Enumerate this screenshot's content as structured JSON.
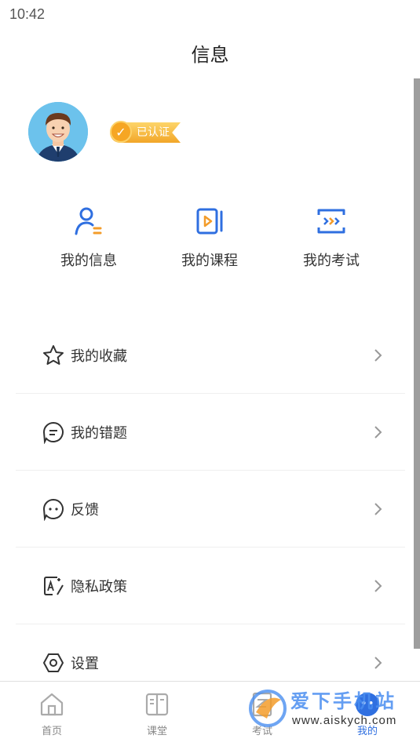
{
  "status_bar": {
    "time": "10:42"
  },
  "header": {
    "title": "信息"
  },
  "profile": {
    "verified_label": "已认证"
  },
  "shortcuts": [
    {
      "label": "我的信息",
      "icon": "user-info-icon"
    },
    {
      "label": "我的课程",
      "icon": "course-play-icon"
    },
    {
      "label": "我的考试",
      "icon": "exam-arrows-icon"
    }
  ],
  "menu": [
    {
      "label": "我的收藏",
      "icon": "star-icon"
    },
    {
      "label": "我的错题",
      "icon": "chat-lines-icon"
    },
    {
      "label": "反馈",
      "icon": "feedback-bubble-icon"
    },
    {
      "label": "隐私政策",
      "icon": "edit-doc-icon"
    },
    {
      "label": "设置",
      "icon": "hexagon-settings-icon"
    }
  ],
  "tabbar": [
    {
      "label": "首页",
      "icon": "home-icon"
    },
    {
      "label": "课堂",
      "icon": "book-icon"
    },
    {
      "label": "考试",
      "icon": "exam-doc-icon"
    },
    {
      "label": "我的",
      "icon": "profile-face-icon",
      "active": true
    }
  ],
  "watermark": {
    "text": "爱下手机站",
    "url": "www.aiskych.com"
  },
  "colors": {
    "accent": "#2f6fe0",
    "icon_orange": "#f39c2a",
    "badge_gold": "#f6a623"
  }
}
